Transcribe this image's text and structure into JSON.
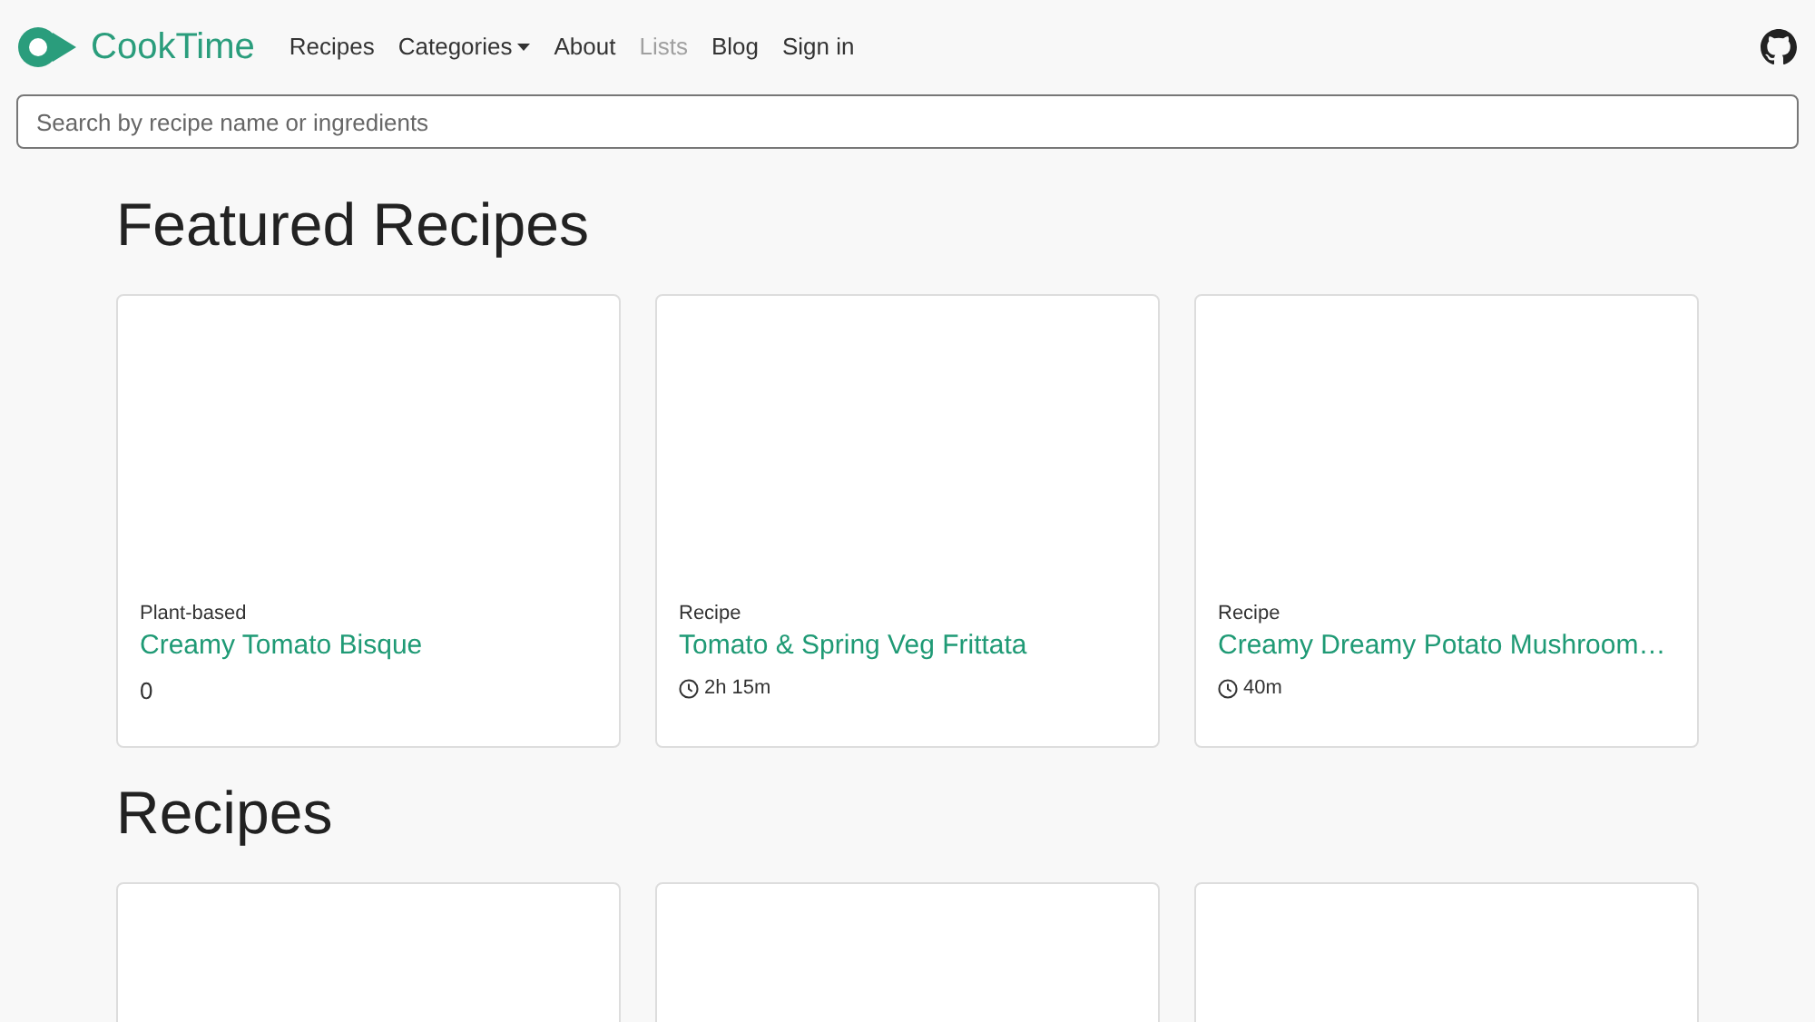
{
  "brand": {
    "name": "CookTime"
  },
  "nav": [
    {
      "label": "Recipes",
      "kind": "link",
      "disabled": false
    },
    {
      "label": "Categories",
      "kind": "dropdown",
      "disabled": false
    },
    {
      "label": "About",
      "kind": "link",
      "disabled": false
    },
    {
      "label": "Lists",
      "kind": "link",
      "disabled": true
    },
    {
      "label": "Blog",
      "kind": "link",
      "disabled": false
    },
    {
      "label": "Sign in",
      "kind": "link",
      "disabled": false
    }
  ],
  "search": {
    "placeholder": "Search by recipe name or ingredients"
  },
  "featured": {
    "heading": "Featured Recipes",
    "cards": [
      {
        "category": "Plant-based",
        "title": "Creamy Tomato Bisque",
        "meta": "0",
        "kind": "plain"
      },
      {
        "category": "Recipe",
        "title": "Tomato & Spring Veg Frittata",
        "meta": "2h 15m",
        "kind": "time"
      },
      {
        "category": "Recipe",
        "title": "Creamy Dreamy Potato Mushroom…",
        "meta": "40m",
        "kind": "time"
      }
    ]
  },
  "recipes": {
    "heading": "Recipes"
  }
}
